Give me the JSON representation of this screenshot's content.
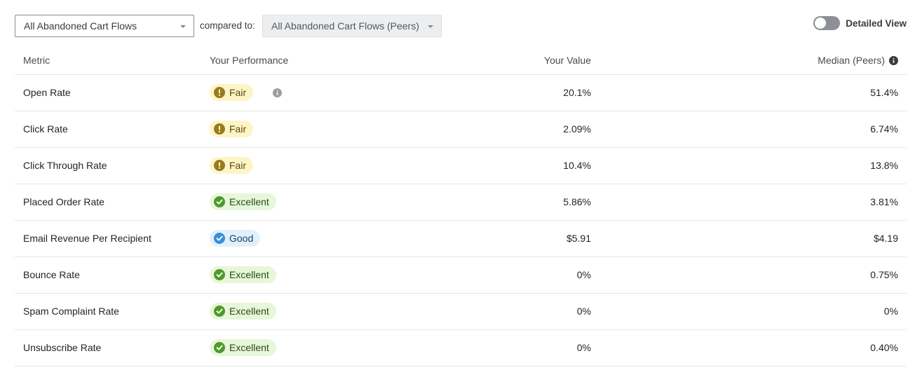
{
  "filters": {
    "primary_select": "All Abandoned Cart Flows",
    "compared_label": "compared to:",
    "peer_select": "All Abandoned Cart Flows (Peers)"
  },
  "toggle": {
    "label": "Detailed View",
    "on": false
  },
  "table": {
    "headers": {
      "metric": "Metric",
      "performance": "Your Performance",
      "value": "Your Value",
      "median": "Median (Peers)"
    },
    "rows": [
      {
        "metric": "Open Rate",
        "rating": "Fair",
        "value": "20.1%",
        "median": "51.4%"
      },
      {
        "metric": "Click Rate",
        "rating": "Fair",
        "value": "2.09%",
        "median": "6.74%"
      },
      {
        "metric": "Click Through Rate",
        "rating": "Fair",
        "value": "10.4%",
        "median": "13.8%"
      },
      {
        "metric": "Placed Order Rate",
        "rating": "Excellent",
        "value": "5.86%",
        "median": "3.81%"
      },
      {
        "metric": "Email Revenue Per Recipient",
        "rating": "Good",
        "value": "$5.91",
        "median": "$4.19"
      },
      {
        "metric": "Bounce Rate",
        "rating": "Excellent",
        "value": "0%",
        "median": "0.75%"
      },
      {
        "metric": "Spam Complaint Rate",
        "rating": "Excellent",
        "value": "0%",
        "median": "0%"
      },
      {
        "metric": "Unsubscribe Rate",
        "rating": "Excellent",
        "value": "0%",
        "median": "0.40%"
      }
    ]
  },
  "colors": {
    "fair_icon": "#9a7a1e",
    "excellent_icon": "#4e9a2a",
    "good_icon": "#3a8fd6",
    "info_icon_header": "#3a3b3e",
    "info_icon_row": "#9a9ca0"
  }
}
